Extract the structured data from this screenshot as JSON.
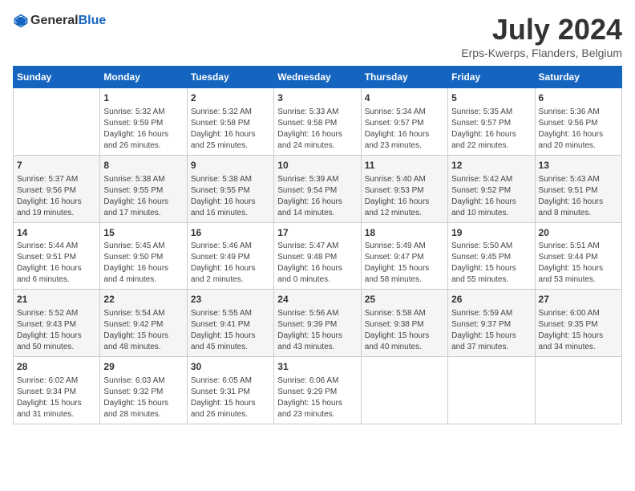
{
  "header": {
    "logo_general": "General",
    "logo_blue": "Blue",
    "title": "July 2024",
    "subtitle": "Erps-Kwerps, Flanders, Belgium"
  },
  "columns": [
    "Sunday",
    "Monday",
    "Tuesday",
    "Wednesday",
    "Thursday",
    "Friday",
    "Saturday"
  ],
  "weeks": [
    [
      {
        "day": "",
        "info": ""
      },
      {
        "day": "1",
        "info": "Sunrise: 5:32 AM\nSunset: 9:59 PM\nDaylight: 16 hours\nand 26 minutes."
      },
      {
        "day": "2",
        "info": "Sunrise: 5:32 AM\nSunset: 9:58 PM\nDaylight: 16 hours\nand 25 minutes."
      },
      {
        "day": "3",
        "info": "Sunrise: 5:33 AM\nSunset: 9:58 PM\nDaylight: 16 hours\nand 24 minutes."
      },
      {
        "day": "4",
        "info": "Sunrise: 5:34 AM\nSunset: 9:57 PM\nDaylight: 16 hours\nand 23 minutes."
      },
      {
        "day": "5",
        "info": "Sunrise: 5:35 AM\nSunset: 9:57 PM\nDaylight: 16 hours\nand 22 minutes."
      },
      {
        "day": "6",
        "info": "Sunrise: 5:36 AM\nSunset: 9:56 PM\nDaylight: 16 hours\nand 20 minutes."
      }
    ],
    [
      {
        "day": "7",
        "info": "Sunrise: 5:37 AM\nSunset: 9:56 PM\nDaylight: 16 hours\nand 19 minutes."
      },
      {
        "day": "8",
        "info": "Sunrise: 5:38 AM\nSunset: 9:55 PM\nDaylight: 16 hours\nand 17 minutes."
      },
      {
        "day": "9",
        "info": "Sunrise: 5:38 AM\nSunset: 9:55 PM\nDaylight: 16 hours\nand 16 minutes."
      },
      {
        "day": "10",
        "info": "Sunrise: 5:39 AM\nSunset: 9:54 PM\nDaylight: 16 hours\nand 14 minutes."
      },
      {
        "day": "11",
        "info": "Sunrise: 5:40 AM\nSunset: 9:53 PM\nDaylight: 16 hours\nand 12 minutes."
      },
      {
        "day": "12",
        "info": "Sunrise: 5:42 AM\nSunset: 9:52 PM\nDaylight: 16 hours\nand 10 minutes."
      },
      {
        "day": "13",
        "info": "Sunrise: 5:43 AM\nSunset: 9:51 PM\nDaylight: 16 hours\nand 8 minutes."
      }
    ],
    [
      {
        "day": "14",
        "info": "Sunrise: 5:44 AM\nSunset: 9:51 PM\nDaylight: 16 hours\nand 6 minutes."
      },
      {
        "day": "15",
        "info": "Sunrise: 5:45 AM\nSunset: 9:50 PM\nDaylight: 16 hours\nand 4 minutes."
      },
      {
        "day": "16",
        "info": "Sunrise: 5:46 AM\nSunset: 9:49 PM\nDaylight: 16 hours\nand 2 minutes."
      },
      {
        "day": "17",
        "info": "Sunrise: 5:47 AM\nSunset: 9:48 PM\nDaylight: 16 hours\nand 0 minutes."
      },
      {
        "day": "18",
        "info": "Sunrise: 5:49 AM\nSunset: 9:47 PM\nDaylight: 15 hours\nand 58 minutes."
      },
      {
        "day": "19",
        "info": "Sunrise: 5:50 AM\nSunset: 9:45 PM\nDaylight: 15 hours\nand 55 minutes."
      },
      {
        "day": "20",
        "info": "Sunrise: 5:51 AM\nSunset: 9:44 PM\nDaylight: 15 hours\nand 53 minutes."
      }
    ],
    [
      {
        "day": "21",
        "info": "Sunrise: 5:52 AM\nSunset: 9:43 PM\nDaylight: 15 hours\nand 50 minutes."
      },
      {
        "day": "22",
        "info": "Sunrise: 5:54 AM\nSunset: 9:42 PM\nDaylight: 15 hours\nand 48 minutes."
      },
      {
        "day": "23",
        "info": "Sunrise: 5:55 AM\nSunset: 9:41 PM\nDaylight: 15 hours\nand 45 minutes."
      },
      {
        "day": "24",
        "info": "Sunrise: 5:56 AM\nSunset: 9:39 PM\nDaylight: 15 hours\nand 43 minutes."
      },
      {
        "day": "25",
        "info": "Sunrise: 5:58 AM\nSunset: 9:38 PM\nDaylight: 15 hours\nand 40 minutes."
      },
      {
        "day": "26",
        "info": "Sunrise: 5:59 AM\nSunset: 9:37 PM\nDaylight: 15 hours\nand 37 minutes."
      },
      {
        "day": "27",
        "info": "Sunrise: 6:00 AM\nSunset: 9:35 PM\nDaylight: 15 hours\nand 34 minutes."
      }
    ],
    [
      {
        "day": "28",
        "info": "Sunrise: 6:02 AM\nSunset: 9:34 PM\nDaylight: 15 hours\nand 31 minutes."
      },
      {
        "day": "29",
        "info": "Sunrise: 6:03 AM\nSunset: 9:32 PM\nDaylight: 15 hours\nand 28 minutes."
      },
      {
        "day": "30",
        "info": "Sunrise: 6:05 AM\nSunset: 9:31 PM\nDaylight: 15 hours\nand 26 minutes."
      },
      {
        "day": "31",
        "info": "Sunrise: 6:06 AM\nSunset: 9:29 PM\nDaylight: 15 hours\nand 23 minutes."
      },
      {
        "day": "",
        "info": ""
      },
      {
        "day": "",
        "info": ""
      },
      {
        "day": "",
        "info": ""
      }
    ]
  ]
}
